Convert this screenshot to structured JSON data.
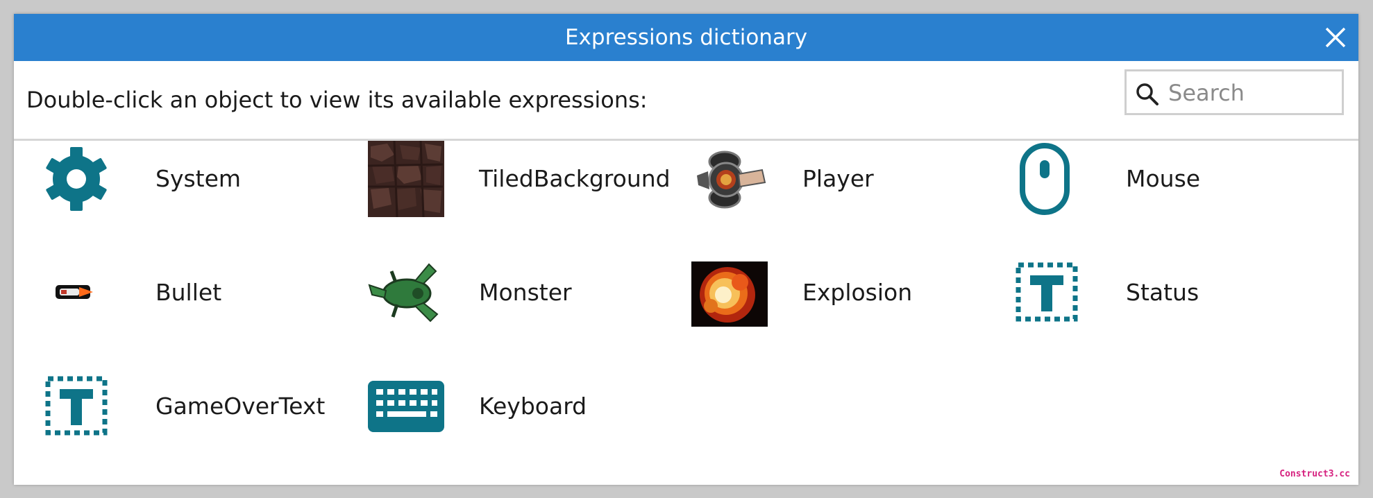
{
  "dialog": {
    "title": "Expressions dictionary",
    "instruction": "Double-click an object to view its available expressions:",
    "search": {
      "placeholder": "Search",
      "value": ""
    },
    "accent_color": "#2a80cf",
    "icon_color": "#0e7488"
  },
  "objects": [
    {
      "label": "System",
      "icon": "gear-icon"
    },
    {
      "label": "TiledBackground",
      "icon": "tiled-background-thumbnail"
    },
    {
      "label": "Player",
      "icon": "player-sprite-thumbnail"
    },
    {
      "label": "Mouse",
      "icon": "mouse-icon"
    },
    {
      "label": "Bullet",
      "icon": "bullet-sprite-thumbnail"
    },
    {
      "label": "Monster",
      "icon": "monster-sprite-thumbnail"
    },
    {
      "label": "Explosion",
      "icon": "explosion-sprite-thumbnail"
    },
    {
      "label": "Status",
      "icon": "text-object-icon"
    },
    {
      "label": "GameOverText",
      "icon": "text-object-icon"
    },
    {
      "label": "Keyboard",
      "icon": "keyboard-icon"
    }
  ],
  "watermark": "Construct3.cc"
}
